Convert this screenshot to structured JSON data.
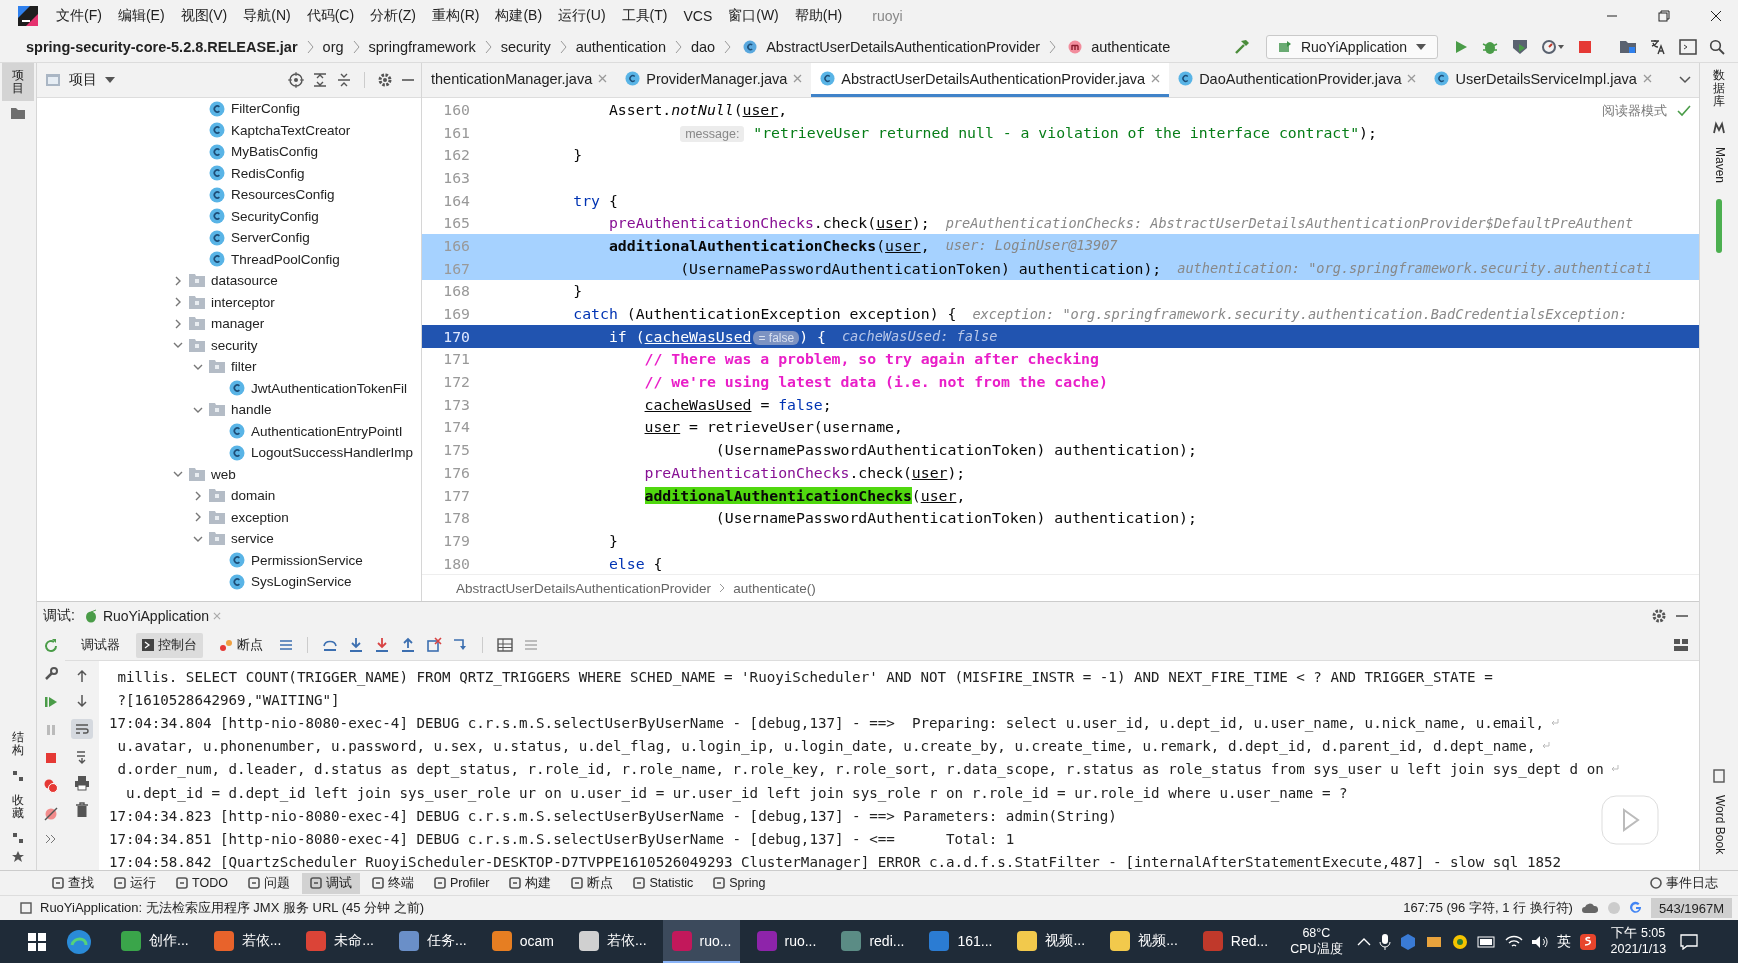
{
  "menu_bar": {
    "items": [
      "文件(F)",
      "编辑(E)",
      "视图(V)",
      "导航(N)",
      "代码(C)",
      "分析(Z)",
      "重构(R)",
      "构建(B)",
      "运行(U)",
      "工具(T)",
      "VCS",
      "窗口(W)",
      "帮助(H)"
    ],
    "project": "ruoyi"
  },
  "nav_bar": {
    "breadcrumbs": [
      {
        "text": "spring-security-core-5.2.8.RELEASE.jar",
        "kind": "jar"
      },
      {
        "text": "org",
        "kind": "folder"
      },
      {
        "text": "springframework",
        "kind": "folder"
      },
      {
        "text": "security",
        "kind": "folder"
      },
      {
        "text": "authentication",
        "kind": "folder"
      },
      {
        "text": "dao",
        "kind": "folder"
      },
      {
        "text": "AbstractUserDetailsAuthenticationProvider",
        "kind": "class"
      },
      {
        "text": "authenticate",
        "kind": "method"
      }
    ],
    "run_config": "RuoYiApplication"
  },
  "side_strip": {
    "left_top": "项目",
    "left_bottom": [
      "结构",
      "收藏"
    ],
    "right_top": "数据库",
    "right_middle": "Maven",
    "right_bottom": "Word Book"
  },
  "project_panel": {
    "title": "项目",
    "tree": [
      {
        "children": [
          {
            "label": "FilterConfig",
            "kind": "class"
          },
          {
            "label": "KaptchaTextCreator",
            "kind": "class"
          },
          {
            "label": "MyBatisConfig",
            "kind": "class"
          },
          {
            "label": "RedisConfig",
            "kind": "class"
          },
          {
            "label": "ResourcesConfig",
            "kind": "class"
          },
          {
            "label": "SecurityConfig",
            "kind": "class"
          },
          {
            "label": "ServerConfig",
            "kind": "class"
          },
          {
            "label": "ThreadPoolConfig",
            "kind": "class"
          }
        ]
      },
      {
        "label": "datasource",
        "kind": "folder",
        "expanded": false
      },
      {
        "label": "interceptor",
        "kind": "folder",
        "expanded": false
      },
      {
        "label": "manager",
        "kind": "folder",
        "expanded": false
      },
      {
        "label": "security",
        "kind": "folder",
        "expanded": true,
        "children": [
          {
            "label": "filter",
            "kind": "folder",
            "expanded": true,
            "children": [
              {
                "label": "JwtAuthenticationTokenFil",
                "kind": "class"
              }
            ]
          },
          {
            "label": "handle",
            "kind": "folder",
            "expanded": true,
            "children": [
              {
                "label": "AuthenticationEntryPointI",
                "kind": "class"
              },
              {
                "label": "LogoutSuccessHandlerImp",
                "kind": "class"
              }
            ]
          }
        ]
      },
      {
        "label": "web",
        "kind": "folder",
        "expanded": true,
        "children": [
          {
            "label": "domain",
            "kind": "folder",
            "expanded": false
          },
          {
            "label": "exception",
            "kind": "folder",
            "expanded": false
          },
          {
            "label": "service",
            "kind": "folder",
            "expanded": true,
            "children": [
              {
                "label": "PermissionService",
                "kind": "class"
              },
              {
                "label": "SysLoginService",
                "kind": "class"
              }
            ]
          }
        ]
      }
    ]
  },
  "editor": {
    "tabs": [
      {
        "label": "thenticationManager.java",
        "selected": false,
        "icon_visible": false
      },
      {
        "label": "ProviderManager.java",
        "selected": false,
        "icon_visible": true
      },
      {
        "label": "AbstractUserDetailsAuthenticationProvider.java",
        "selected": true,
        "icon_visible": true
      },
      {
        "label": "DaoAuthenticationProvider.java",
        "selected": false,
        "icon_visible": true
      },
      {
        "label": "UserDetailsServiceImpl.java",
        "selected": false,
        "icon_visible": true
      }
    ],
    "reader_mode": "阅读器模式",
    "lines": [
      {
        "number": "160",
        "selected": false,
        "current": false,
        "segments": [
          {
            "text": "            Assert.",
            "kind": "plain"
          },
          {
            "text": "notNull",
            "kind": "static"
          },
          {
            "text": "(",
            "kind": "plain"
          },
          {
            "text": "user",
            "kind": "var"
          },
          {
            "text": ",",
            "kind": "plain"
          }
        ]
      },
      {
        "number": "161",
        "selected": false,
        "current": false,
        "segments": [
          {
            "text": "                    message:",
            "kind": "param"
          },
          {
            "text": " \"retrieveUser returned null - a violation of the interface contract\"",
            "kind": "string"
          },
          {
            "text": ");",
            "kind": "plain"
          }
        ]
      },
      {
        "number": "162",
        "selected": false,
        "current": false,
        "segments": [
          {
            "text": "        }",
            "kind": "plain"
          }
        ]
      },
      {
        "number": "163",
        "selected": false,
        "current": false
      },
      {
        "number": "164",
        "selected": false,
        "current": false,
        "segments": [
          {
            "text": "        try",
            "kind": "keyword"
          },
          {
            "text": " {",
            "kind": "plain"
          }
        ]
      },
      {
        "number": "165",
        "selected": false,
        "current": false,
        "segments": [
          {
            "text": "            preAuthenticationChecks",
            "kind": "field"
          },
          {
            "text": ".check(",
            "kind": "plain"
          },
          {
            "text": "user",
            "kind": "var"
          },
          {
            "text": ");",
            "kind": "plain"
          }
        ],
        "hint": "preAuthenticationChecks: AbstractUserDetailsAuthenticationProvider$DefaultPreAuthent"
      },
      {
        "number": "166",
        "selected": true,
        "current": false,
        "segments": [
          {
            "text": "            additionalAuthenticationChecks",
            "kind": "bold"
          },
          {
            "text": "(",
            "kind": "plain"
          },
          {
            "text": "user",
            "kind": "var"
          },
          {
            "text": ",",
            "kind": "plain"
          }
        ],
        "hint": "user: LoginUser@13907"
      },
      {
        "number": "167",
        "selected": true,
        "current": false,
        "segments": [
          {
            "text": "                    (UsernamePasswordAuthenticationToken) authentication);",
            "kind": "plain"
          }
        ],
        "hint": "authentication: \"org.springframework.security.authenticati"
      },
      {
        "number": "168",
        "selected": false,
        "current": false,
        "segments": [
          {
            "text": "        }",
            "kind": "plain"
          }
        ]
      },
      {
        "number": "169",
        "selected": false,
        "current": false,
        "segments": [
          {
            "text": "        catch",
            "kind": "keyword"
          },
          {
            "text": " (AuthenticationException exception) {",
            "kind": "plain"
          }
        ],
        "hint": "exception: \"org.springframework.security.authentication.BadCredentialsException:"
      },
      {
        "number": "170",
        "selected": false,
        "current": true,
        "segments": [
          {
            "text": "            if",
            "kind": "keyword"
          },
          {
            "text": " (",
            "kind": "plain"
          },
          {
            "text": "cacheWasUsed",
            "kind": "var"
          },
          {
            "text": "= false",
            "kind": "value"
          },
          {
            "text": ") {",
            "kind": "plain"
          }
        ],
        "hint": "cacheWasUsed: false"
      },
      {
        "number": "171",
        "selected": false,
        "current": false,
        "segments": [
          {
            "text": "                // There was a problem, so try again after checking",
            "kind": "comment"
          }
        ]
      },
      {
        "number": "172",
        "selected": false,
        "current": false,
        "segments": [
          {
            "text": "                // we're using latest data (i.e. not from the cache)",
            "kind": "comment"
          }
        ]
      },
      {
        "number": "173",
        "selected": false,
        "current": false,
        "segments": [
          {
            "text": "                cacheWasUsed",
            "kind": "var"
          },
          {
            "text": " = ",
            "kind": "plain"
          },
          {
            "text": "false",
            "kind": "keyword"
          },
          {
            "text": ";",
            "kind": "plain"
          }
        ]
      },
      {
        "number": "174",
        "selected": false,
        "current": false,
        "segments": [
          {
            "text": "                user",
            "kind": "var"
          },
          {
            "text": " = retrieveUser(username,",
            "kind": "plain"
          }
        ]
      },
      {
        "number": "175",
        "selected": false,
        "current": false,
        "segments": [
          {
            "text": "                        (UsernamePasswordAuthenticationToken) authentication);",
            "kind": "plain"
          }
        ]
      },
      {
        "number": "176",
        "selected": false,
        "current": false,
        "segments": [
          {
            "text": "                preAuthenticationChecks",
            "kind": "field"
          },
          {
            "text": ".check(",
            "kind": "plain"
          },
          {
            "text": "user",
            "kind": "var"
          },
          {
            "text": ");",
            "kind": "plain"
          }
        ]
      },
      {
        "number": "177",
        "selected": false,
        "current": false,
        "segments": [
          {
            "text": "                additionalAuthenticationChecks",
            "kind": "match"
          },
          {
            "text": "(",
            "kind": "plain"
          },
          {
            "text": "user",
            "kind": "var"
          },
          {
            "text": ",",
            "kind": "plain"
          }
        ]
      },
      {
        "number": "178",
        "selected": false,
        "current": false,
        "segments": [
          {
            "text": "                        (UsernamePasswordAuthenticationToken) authentication);",
            "kind": "plain"
          }
        ]
      },
      {
        "number": "179",
        "selected": false,
        "current": false,
        "segments": [
          {
            "text": "            }",
            "kind": "plain"
          }
        ]
      },
      {
        "number": "180",
        "selected": false,
        "current": false,
        "segments": [
          {
            "text": "            else",
            "kind": "keyword"
          },
          {
            "text": " {",
            "kind": "plain"
          }
        ]
      }
    ],
    "breadcrumbs": [
      "AbstractUserDetailsAuthenticationProvider",
      "authenticate()"
    ]
  },
  "debug_panel": {
    "label": "调试:",
    "session": "RuoYiApplication",
    "tabs": [
      {
        "label": "调试器",
        "selected": false
      },
      {
        "label": "控制台",
        "selected": true
      },
      {
        "label": "断点",
        "selected": false
      }
    ],
    "console": [
      {
        "text": " millis. SELECT COUNT(TRIGGER_NAME) FROM QRTZ_TRIGGERS WHERE SCHED_NAME = 'RuoyiScheduler' AND NOT (MISFIRE_INSTR = -1) AND NEXT_FIRE_TIME < ? AND TRIGGER_STATE =",
        "wrapped": false
      },
      {
        "text": " ?[1610528642969,\"WAITING\"]",
        "wrapped": false
      },
      {
        "text": "17:04:34.804 [http-nio-8080-exec-4] DEBUG c.r.s.m.S.selectUserByUserName - [debug,137] - ==>  Preparing: select u.user_id, u.dept_id, u.user_name, u.nick_name, u.email,",
        "wrapped": true
      },
      {
        "text": " u.avatar, u.phonenumber, u.password, u.sex, u.status, u.del_flag, u.login_ip, u.login_date, u.create_by, u.create_time, u.remark, d.dept_id, d.parent_id, d.dept_name,",
        "wrapped": true
      },
      {
        "text": " d.order_num, d.leader, d.status as dept_status, r.role_id, r.role_name, r.role_key, r.role_sort, r.data_scope, r.status as role_status from sys_user u left join sys_dept d on",
        "wrapped": true
      },
      {
        "text": "  u.dept_id = d.dept_id left join sys_user_role ur on u.user_id = ur.user_id left join sys_role r on r.role_id = ur.role_id where u.user_name = ?",
        "wrapped": false
      },
      {
        "text": "17:04:34.823 [http-nio-8080-exec-4] DEBUG c.r.s.m.S.selectUserByUserName - [debug,137] - ==> Parameters: admin(String)",
        "wrapped": false
      },
      {
        "text": "17:04:34.851 [http-nio-8080-exec-4] DEBUG c.r.s.m.S.selectUserByUserName - [debug,137] - <==      Total: 1",
        "wrapped": false
      },
      {
        "text": "17:04:58.842 [QuartzScheduler_RuoyiScheduler-DESKTOP-D7TVPPE1610526049293_ClusterManager] ERROR c.a.d.f.s.StatFilter - [internalAfterStatementExecute,487] - slow sql 1852",
        "wrapped": false
      }
    ]
  },
  "tool_tabs": {
    "items": [
      {
        "label": "查找",
        "selected": false
      },
      {
        "label": "运行",
        "selected": false
      },
      {
        "label": "TODO",
        "selected": false
      },
      {
        "label": "问题",
        "selected": false
      },
      {
        "label": "调试",
        "selected": true
      },
      {
        "label": "终端",
        "selected": false
      },
      {
        "label": "Profiler",
        "selected": false
      },
      {
        "label": "构建",
        "selected": false
      },
      {
        "label": "断点",
        "selected": false
      },
      {
        "label": "Statistic",
        "selected": false
      },
      {
        "label": "Spring",
        "selected": false
      }
    ],
    "event_log": "事件日志"
  },
  "status_bar": {
    "message": "RuoYiApplication: 无法检索应用程序 JMX 服务 URL (45 分钟 之前)",
    "position": "167:75 (96 字符, 1 行 换行符)",
    "memory": "543/1967M"
  },
  "taskbar": {
    "apps": [
      {
        "label": "创作...",
        "selected": false,
        "color": "#3aa54a"
      },
      {
        "label": "若依...",
        "selected": false,
        "color": "#e8632b"
      },
      {
        "label": "未命...",
        "selected": false,
        "color": "#db4437"
      },
      {
        "label": "任务...",
        "selected": false,
        "color": "#6a8fc8"
      },
      {
        "label": "ocam",
        "selected": false,
        "color": "#e67e22"
      },
      {
        "label": "若依...",
        "selected": false,
        "color": "#d0d0d0"
      },
      {
        "label": "ruo...",
        "selected": true,
        "color": "#c2185b"
      },
      {
        "label": "ruo...",
        "selected": false,
        "color": "#8e24aa"
      },
      {
        "label": "redi...",
        "selected": false,
        "color": "#5b8c85"
      },
      {
        "label": "161...",
        "selected": false,
        "color": "#2b7cd3"
      },
      {
        "label": "视频...",
        "selected": false,
        "color": "#f2c94c"
      },
      {
        "label": "视频...",
        "selected": false,
        "color": "#f2c94c"
      },
      {
        "label": "Red...",
        "selected": false,
        "color": "#c0392b"
      }
    ],
    "temperature": "68°C",
    "temperature_label": "CPU温度",
    "ime": "英",
    "time": "下午 5:05",
    "date": "2021/1/13"
  }
}
